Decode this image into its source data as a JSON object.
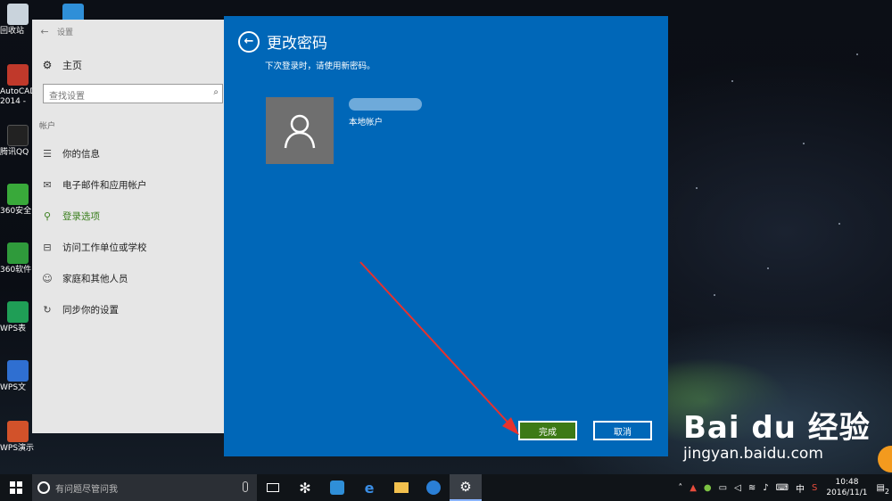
{
  "desktop": {
    "icons": [
      {
        "label": "回收站"
      },
      {
        "label": "AutoCAD 2014 -"
      },
      {
        "label": "腾讯QQ"
      },
      {
        "label": "360安全"
      },
      {
        "label": "360软件"
      },
      {
        "label": "WPS表"
      },
      {
        "label": "WPS文"
      },
      {
        "label": "WPS演示"
      }
    ]
  },
  "settings": {
    "title": "设置",
    "home_label": "主页",
    "search_placeholder": "查找设置",
    "section_label": "帐户",
    "nav_items": [
      {
        "label": "你的信息",
        "icon": "person-card-icon"
      },
      {
        "label": "电子邮件和应用帐户",
        "icon": "mail-icon"
      },
      {
        "label": "登录选项",
        "icon": "key-icon",
        "active": true
      },
      {
        "label": "访问工作单位或学校",
        "icon": "briefcase-icon"
      },
      {
        "label": "家庭和其他人员",
        "icon": "people-icon"
      },
      {
        "label": "同步你的设置",
        "icon": "sync-icon"
      }
    ]
  },
  "dialog": {
    "title": "更改密码",
    "subtitle": "下次登录时，请使用新密码。",
    "account_type": "本地帐户",
    "finish_label": "完成",
    "cancel_label": "取消"
  },
  "watermark": {
    "logo": "Bai du 经验",
    "url": "jingyan.baidu.com"
  },
  "taskbar": {
    "search_placeholder": "有问题尽管问我",
    "tray": {
      "time": "10:48",
      "date": "2016/11/1",
      "ime": "中",
      "notification_count": "2"
    }
  },
  "colors": {
    "dialog_bg": "#0067b8",
    "finish_button": "#3d7a16",
    "active_nav": "#3b7f1e"
  }
}
